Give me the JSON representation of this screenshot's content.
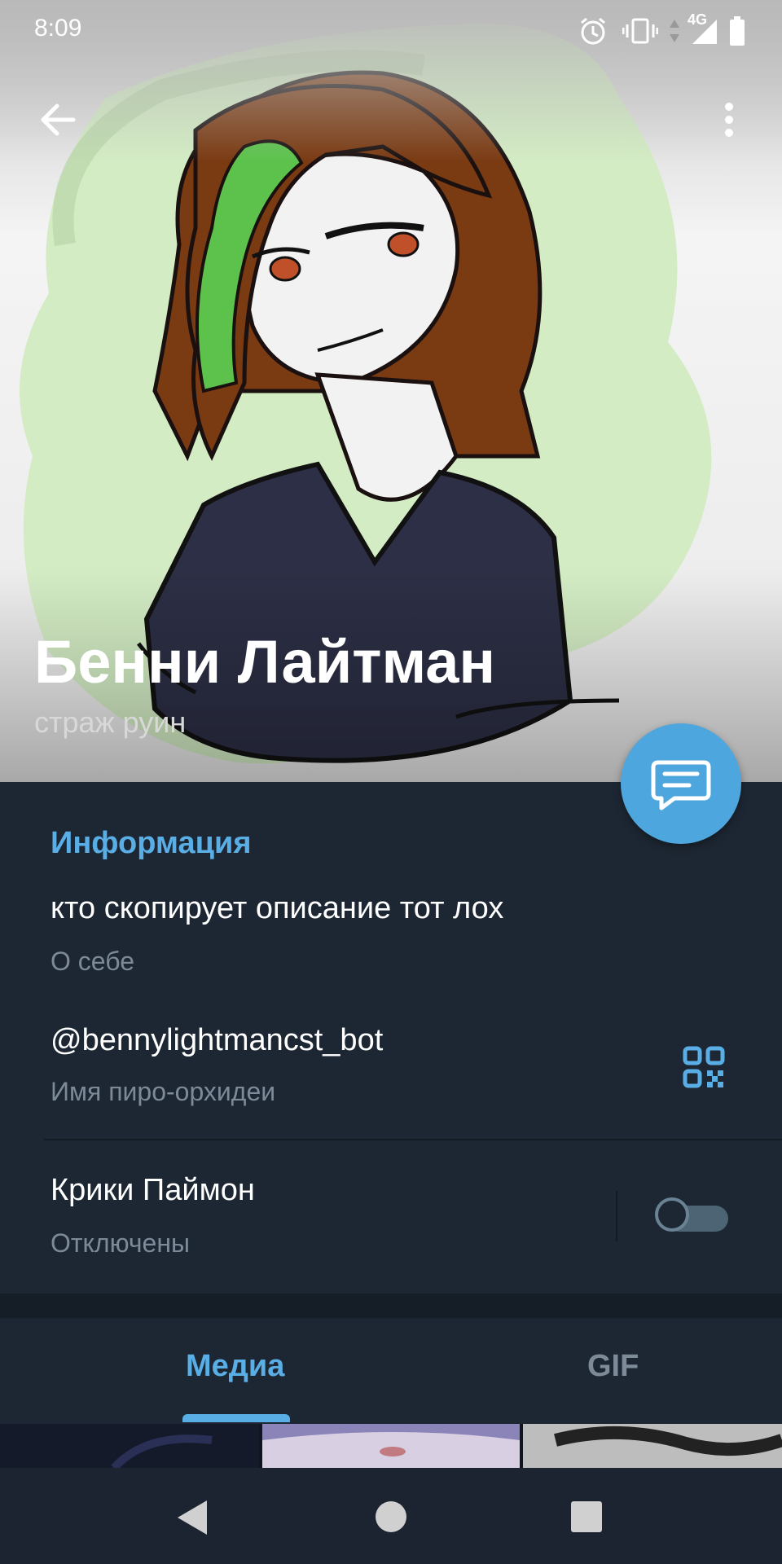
{
  "status_bar": {
    "time": "8:09",
    "network_label": "4G",
    "icons": [
      "alarm-icon",
      "vibrate-icon",
      "data-arrows-icon",
      "signal-icon",
      "battery-icon"
    ]
  },
  "toolbar": {
    "back_icon": "arrow-left-icon",
    "menu_icon": "more-vertical-icon"
  },
  "profile": {
    "name": "Бенни Лайтман",
    "status": "страж руин"
  },
  "fab": {
    "icon": "message-icon"
  },
  "info": {
    "section_title": "Информация",
    "bio": {
      "value": "кто скопирует описание тот лох",
      "label": "О себе"
    },
    "username": {
      "value": "@bennylightmancst_bot",
      "label": "Имя пиро-орхидеи",
      "icon": "qr-code-icon"
    },
    "notifications": {
      "value": "Крики Паймон",
      "label": "Отключены",
      "enabled": false
    }
  },
  "tabs": [
    {
      "label": "Медиа",
      "active": true
    },
    {
      "label": "GIF",
      "active": false
    }
  ],
  "colors": {
    "accent": "#5aaee6",
    "fab": "#4ea6de",
    "background": "#1d2733",
    "secondary_text": "#7d8b99"
  },
  "navbar": {
    "icons": [
      "nav-back-icon",
      "nav-home-icon",
      "nav-recents-icon"
    ]
  }
}
